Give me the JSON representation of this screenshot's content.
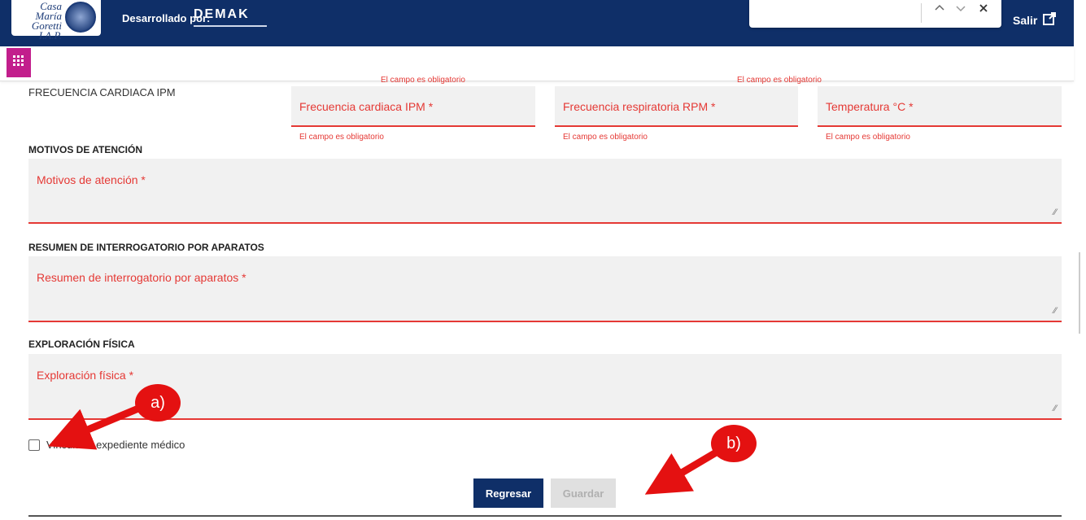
{
  "header": {
    "logo_text": "Casa María Goretti I.A.P.",
    "developed_by": "Desarrollado por:",
    "brand": "DEMAK",
    "logout_label": "Salir"
  },
  "search": {
    "prev_icon": "chevron-up-icon",
    "next_icon": "chevron-down-icon",
    "close_icon": "close-icon"
  },
  "vitals": {
    "label": "FRECUENCIA CARDIACA IPM",
    "top_errors": [
      "El campo es obligatorio",
      "El campo es obligatorio"
    ],
    "fields": [
      {
        "label": "Frecuencia cardiaca IPM *",
        "error": "El campo es obligatorio"
      },
      {
        "label": "Frecuencia respiratoria RPM *",
        "error": "El campo es obligatorio"
      },
      {
        "label": "Temperatura °C *",
        "error": "El campo es obligatorio"
      }
    ]
  },
  "sections": {
    "motivos": {
      "title": "MOTIVOS DE ATENCIÓN",
      "placeholder": "Motivos de atención *"
    },
    "resumen": {
      "title": "RESUMEN DE INTERROGATORIO POR APARATOS",
      "placeholder": "Resumen de interrogatorio por aparatos *"
    },
    "exploracion": {
      "title": "EXPLORACIÓN FÍSICA",
      "placeholder": "Exploración física *"
    }
  },
  "link_checkbox": {
    "label": "Vincular a expediente médico",
    "checked": false
  },
  "actions": {
    "back": "Regresar",
    "save": "Guardar"
  },
  "annotations": {
    "a": "a)",
    "b": "b)"
  },
  "colors": {
    "primary": "#0f2f68",
    "accent": "#c21e8c",
    "error": "#e53935",
    "callout": "#e41111"
  }
}
